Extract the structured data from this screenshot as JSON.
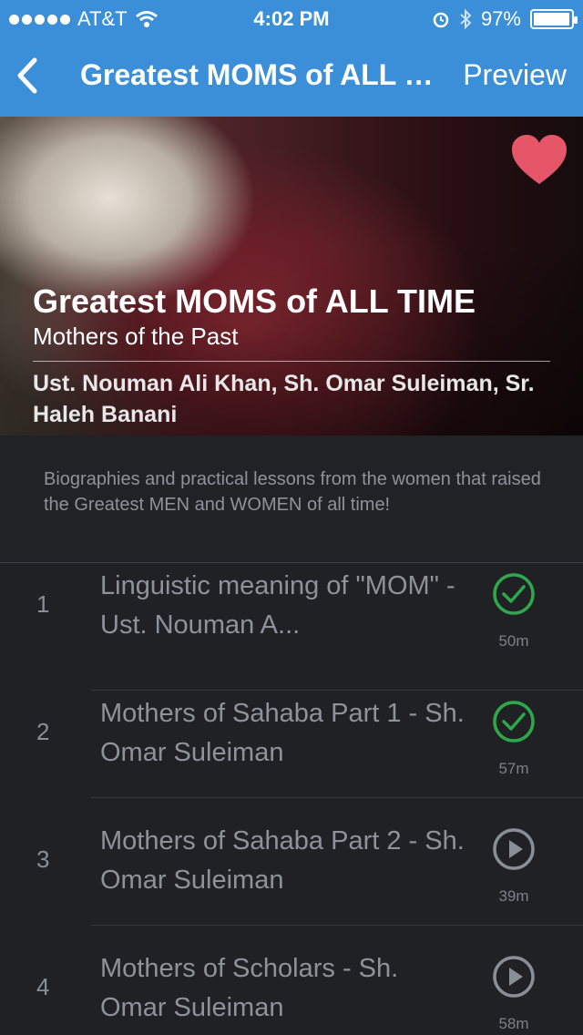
{
  "status_bar": {
    "carrier": "AT&T",
    "time": "4:02 PM",
    "battery": "97%",
    "battery_level": 0.97,
    "icons": [
      "signal-dots-icon",
      "wifi-icon",
      "alarm-icon",
      "bluetooth-icon",
      "battery-icon"
    ]
  },
  "nav": {
    "back_icon": "chevron-left-icon",
    "title": "Greatest MOMS of ALL TIME",
    "preview_label": "Preview"
  },
  "hero": {
    "title": "Greatest MOMS of ALL TIME",
    "subtitle": "Mothers of the Past",
    "authors": "Ust. Nouman Ali Khan, Sh. Omar Suleiman, Sr. Haleh Banani",
    "favorite_icon": "heart-icon",
    "favorite_color": "#e55768"
  },
  "description": "Biographies and practical lessons from the women that raised the Greatest MEN and WOMEN of all time!",
  "episodes": [
    {
      "number": "1",
      "title": "Linguistic meaning of \"MOM\" - Ust. Nouman A...",
      "duration": "50m",
      "status": "completed",
      "icon": "check-circle-icon"
    },
    {
      "number": "2",
      "title": "Mothers of Sahaba Part 1 - Sh. Omar Suleiman",
      "duration": "57m",
      "status": "completed",
      "icon": "check-circle-icon"
    },
    {
      "number": "3",
      "title": "Mothers of Sahaba Part 2 - Sh. Omar Suleiman",
      "duration": "39m",
      "status": "play",
      "icon": "play-circle-icon"
    },
    {
      "number": "4",
      "title": "Mothers of Scholars - Sh. Omar Suleiman",
      "duration": "58m",
      "status": "play",
      "icon": "play-circle-icon"
    }
  ],
  "colors": {
    "accent": "#3a8fd8",
    "completed": "#2ea84a",
    "play_icon": "#8a8f96",
    "background": "#1f2124"
  }
}
